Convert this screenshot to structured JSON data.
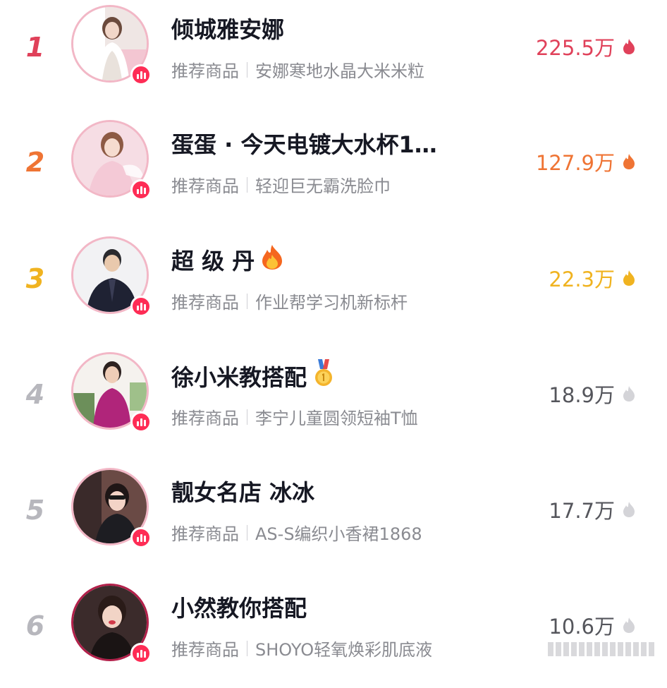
{
  "rows": [
    {
      "rank": "1",
      "name": "倾城雅安娜",
      "label": "推荐商品",
      "product": "安娜寒地水晶大米米粒",
      "heat": "225.5万",
      "color": "#e0415a",
      "badge": ""
    },
    {
      "rank": "2",
      "name": "蛋蛋 · 今天电镀大水杯1…",
      "label": "推荐商品",
      "product": "轻迎巨无霸洗脸巾",
      "heat": "127.9万",
      "color": "#ef7434",
      "badge": ""
    },
    {
      "rank": "3",
      "name": "超 级 丹",
      "label": "推荐商品",
      "product": "作业帮学习机新标杆",
      "heat": "22.3万",
      "color": "#f0b320",
      "badge": "fire"
    },
    {
      "rank": "4",
      "name": "徐小米教搭配",
      "label": "推荐商品",
      "product": "李宁儿童圆领短袖T恤",
      "heat": "18.9万",
      "color": "#b7b7bd",
      "badge": "medal"
    },
    {
      "rank": "5",
      "name": "靓女名店 冰冰",
      "label": "推荐商品",
      "product": "AS-S编织小香裙1868",
      "heat": "17.7万",
      "color": "#b7b7bd",
      "badge": ""
    },
    {
      "rank": "6",
      "name": "小然教你搭配",
      "label": "推荐商品",
      "product": "SHOYO轻氧焕彩肌底液",
      "heat": "10.6万",
      "color": "#b7b7bd",
      "badge": ""
    }
  ],
  "colors": {
    "live_badge": "#fe2c55",
    "name_text": "#161823",
    "sub_text": "#8a8b91",
    "heat_grey": "#55565c"
  },
  "icons": {
    "live": "live-bars-icon",
    "heat": "flame-icon",
    "fire_badge": "fire-emoji-icon",
    "medal_badge": "gold-medal-icon"
  }
}
